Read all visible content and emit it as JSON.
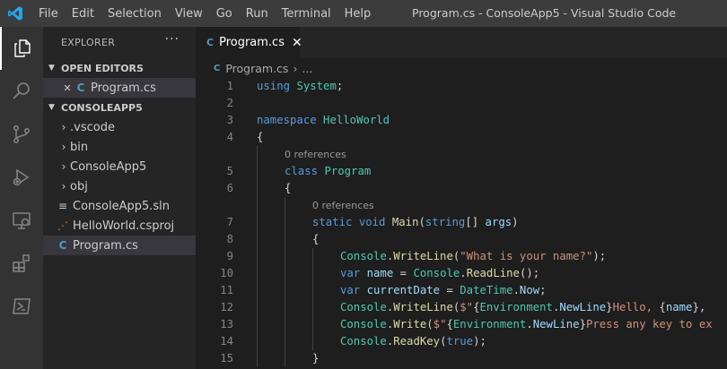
{
  "titlebar": {
    "menu": [
      "File",
      "Edit",
      "Selection",
      "View",
      "Go",
      "Run",
      "Terminal",
      "Help"
    ],
    "window_title": "Program.cs - ConsoleApp5 - Visual Studio Code"
  },
  "activity_bar": {
    "icons": [
      "explorer-icon",
      "search-icon",
      "source-control-icon",
      "run-debug-icon",
      "remote-explorer-icon",
      "extensions-icon",
      "powershell-icon"
    ]
  },
  "sidebar": {
    "header": "EXPLORER",
    "more": "···",
    "open_editors": {
      "label": "OPEN EDITORS",
      "items": [
        {
          "close": "✕",
          "icon": "C",
          "label": "Program.cs"
        }
      ]
    },
    "project": {
      "label": "CONSOLEAPP5",
      "items": [
        {
          "type": "folder",
          "label": ".vscode"
        },
        {
          "type": "folder",
          "label": "bin"
        },
        {
          "type": "folder",
          "label": "ConsoleApp5"
        },
        {
          "type": "folder",
          "label": "obj"
        },
        {
          "type": "sln",
          "label": "ConsoleApp5.sln"
        },
        {
          "type": "csproj",
          "label": "HelloWorld.csproj"
        },
        {
          "type": "cs",
          "label": "Program.cs"
        }
      ]
    }
  },
  "editor": {
    "tab": {
      "label": "Program.cs",
      "close": "✕"
    },
    "breadcrumb": {
      "file": "Program.cs",
      "sep": "›",
      "more": "..."
    },
    "code_lines": [
      {
        "num": "1",
        "tokens": [
          [
            "kw",
            "using"
          ],
          [
            "",
            " "
          ],
          [
            "ty",
            "System"
          ],
          [
            "",
            ";"
          ]
        ]
      },
      {
        "num": "2",
        "tokens": []
      },
      {
        "num": "3",
        "tokens": [
          [
            "kw",
            "namespace"
          ],
          [
            "",
            " "
          ],
          [
            "ty",
            "HelloWorld"
          ]
        ]
      },
      {
        "num": "4",
        "tokens": [
          [
            "",
            "{"
          ]
        ]
      },
      {
        "lens": "0 references",
        "indent": 1
      },
      {
        "num": "5",
        "indent": 1,
        "tokens": [
          [
            "kw",
            "class"
          ],
          [
            "",
            " "
          ],
          [
            "ty",
            "Program"
          ]
        ]
      },
      {
        "num": "6",
        "indent": 1,
        "tokens": [
          [
            "",
            "{"
          ]
        ]
      },
      {
        "lens": "0 references",
        "indent": 2
      },
      {
        "num": "7",
        "indent": 2,
        "tokens": [
          [
            "kw",
            "static"
          ],
          [
            "",
            " "
          ],
          [
            "kw",
            "void"
          ],
          [
            "",
            " "
          ],
          [
            "fn",
            "Main"
          ],
          [
            "",
            "("
          ],
          [
            "kw",
            "string"
          ],
          [
            "",
            "[] "
          ],
          [
            "pa",
            "args"
          ],
          [
            "",
            ")"
          ]
        ]
      },
      {
        "num": "8",
        "indent": 2,
        "tokens": [
          [
            "",
            "{"
          ]
        ]
      },
      {
        "num": "9",
        "indent": 3,
        "tokens": [
          [
            "ty",
            "Console"
          ],
          [
            "",
            "."
          ],
          [
            "fn",
            "WriteLine"
          ],
          [
            "",
            "("
          ],
          [
            "st",
            "\"What is your name?\""
          ],
          [
            "",
            ");"
          ]
        ]
      },
      {
        "num": "10",
        "indent": 3,
        "tokens": [
          [
            "kw",
            "var"
          ],
          [
            "",
            " "
          ],
          [
            "pa",
            "name"
          ],
          [
            "",
            " = "
          ],
          [
            "ty",
            "Console"
          ],
          [
            "",
            "."
          ],
          [
            "fn",
            "ReadLine"
          ],
          [
            "",
            "();"
          ]
        ]
      },
      {
        "num": "11",
        "indent": 3,
        "tokens": [
          [
            "kw",
            "var"
          ],
          [
            "",
            " "
          ],
          [
            "pa",
            "currentDate"
          ],
          [
            "",
            " = "
          ],
          [
            "ty",
            "DateTime"
          ],
          [
            "",
            "."
          ],
          [
            "pa",
            "Now"
          ],
          [
            "",
            ";"
          ]
        ]
      },
      {
        "num": "12",
        "indent": 3,
        "tokens": [
          [
            "ty",
            "Console"
          ],
          [
            "",
            "."
          ],
          [
            "fn",
            "WriteLine"
          ],
          [
            "",
            "("
          ],
          [
            "st",
            "$\""
          ],
          [
            "",
            "{"
          ],
          [
            "ty",
            "Environment"
          ],
          [
            "",
            "."
          ],
          [
            "pa",
            "NewLine"
          ],
          [
            "",
            "}"
          ],
          [
            "st",
            "Hello, "
          ],
          [
            "",
            "{"
          ],
          [
            "pa",
            "name"
          ],
          [
            "",
            "}, "
          ]
        ]
      },
      {
        "num": "13",
        "indent": 3,
        "tokens": [
          [
            "ty",
            "Console"
          ],
          [
            "",
            "."
          ],
          [
            "fn",
            "Write"
          ],
          [
            "",
            "("
          ],
          [
            "st",
            "$\""
          ],
          [
            "",
            "{"
          ],
          [
            "ty",
            "Environment"
          ],
          [
            "",
            "."
          ],
          [
            "pa",
            "NewLine"
          ],
          [
            "",
            "}"
          ],
          [
            "st",
            "Press any key to ex"
          ]
        ]
      },
      {
        "num": "14",
        "indent": 3,
        "tokens": [
          [
            "ty",
            "Console"
          ],
          [
            "",
            "."
          ],
          [
            "fn",
            "ReadKey"
          ],
          [
            "",
            "("
          ],
          [
            "kw",
            "true"
          ],
          [
            "",
            ");"
          ]
        ]
      },
      {
        "num": "15",
        "indent": 2,
        "tokens": [
          [
            "",
            "}"
          ]
        ]
      }
    ]
  }
}
